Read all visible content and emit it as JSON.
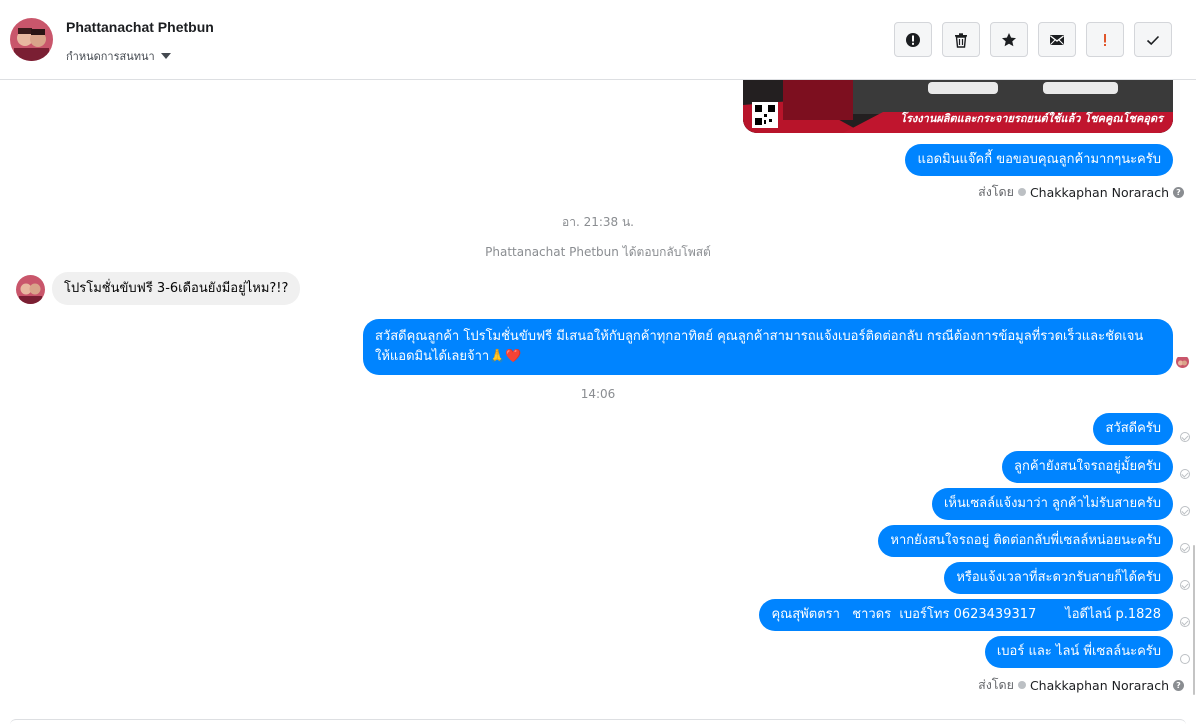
{
  "header": {
    "contact_name": "Phattanachat Phetbun",
    "assign_label": "กำหนดการสนทนา",
    "actions": [
      {
        "name": "spam-button",
        "icon": "alert-circle-icon"
      },
      {
        "name": "delete-button",
        "icon": "trash-icon"
      },
      {
        "name": "star-button",
        "icon": "star-icon"
      },
      {
        "name": "mark-unread-button",
        "icon": "envelope-icon"
      },
      {
        "name": "follow-up-button",
        "icon": "exclamation-icon"
      },
      {
        "name": "mark-done-button",
        "icon": "checkmark-icon"
      }
    ]
  },
  "chat": {
    "promo_image": {
      "caption": "โรงงานผลิตและกระจายรถยนต์ใช้แล้ว โชคคูณโชคอุดร"
    },
    "messages_block1": [
      "แอดมินแจ๊คกี้ ขอขอบคุณลูกค้ามากๆนะครับ"
    ],
    "sent_by_label": "ส่งโดย",
    "agent_name": "Chakkaphan Norarach",
    "time_sep_1": "อา. 21:38 น.",
    "system_note": "Phattanachat Phetbun ได้ตอบกลับโพสต์",
    "incoming_message": "โปรโมชั่นขับฟรี 3-6เดือนยังมีอยู่ไหม?!?",
    "long_reply": "สวัสดีคุณลูกค้า โปรโมชั่นขับฟรี มีเสนอให้กับลูกค้าทุกอาทิตย์ คุณลูกค้าสามารถแจ้งเบอร์ติดต่อกลับ กรณีต้องการข้อมูลที่รวดเร็วและชัดเจน ให้แอดมินได้เลยจ้าา🙏❤️",
    "time_sep_2": "14:06",
    "messages_block2": [
      "สวัสดีครับ",
      "ลูกค้ายังสนใจรถอยู่มั้ยครับ",
      "เห็นเซลล์แจ้งมาว่า ลูกค้าไม่รับสายครับ",
      "หากยังสนใจรถอยู่ ติดต่อกลับพี่เซลล์หน่อยนะครับ",
      "หรือแจ้งเวลาที่สะดวกรับสายก็ได้ครับ",
      "คุณสุพัตตรา   ชาวดร  เบอร์โทร 0623439317       ไอดีไลน์ p.1828",
      "เบอร์ และ ไลน์ พี่เซลล์นะครับ"
    ]
  },
  "colors": {
    "outgoing": "#0084ff",
    "incoming": "#f0f0f0"
  }
}
